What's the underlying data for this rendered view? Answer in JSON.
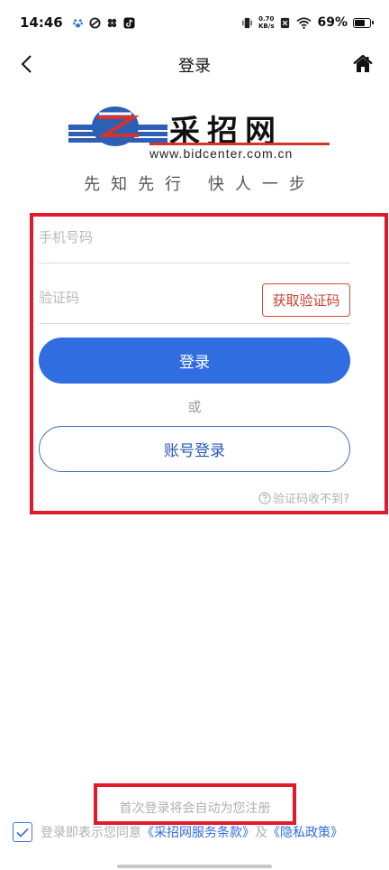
{
  "status_bar": {
    "time": "14:46",
    "net_speed_value": "0.70",
    "net_speed_unit": "KB/s",
    "battery": "69%",
    "battery_level": 0.69
  },
  "nav": {
    "title": "登录",
    "back_icon": "chevron-left-icon",
    "home_icon": "home-icon"
  },
  "logo": {
    "name": "采招网",
    "url": "www.bidcenter.com.cn",
    "slogan": "先知先行 快人一步"
  },
  "form": {
    "phone_placeholder": "手机号码",
    "code_placeholder": "验证码",
    "get_code_label": "获取验证码",
    "login_label": "登录",
    "or_label": "或",
    "account_login_label": "账号登录",
    "no_code_label": "验证码收不到?"
  },
  "footer": {
    "first_login_note": "首次登录将会自动为您注册",
    "agree_prefix": "登录即表示您同意",
    "terms_link": "《采招网服务条款》",
    "and_text": "及",
    "privacy_link": "《隐私政策》"
  },
  "colors": {
    "primary": "#2f6de0",
    "highlight": "#e21b2c",
    "code_button": "#c8412f"
  }
}
